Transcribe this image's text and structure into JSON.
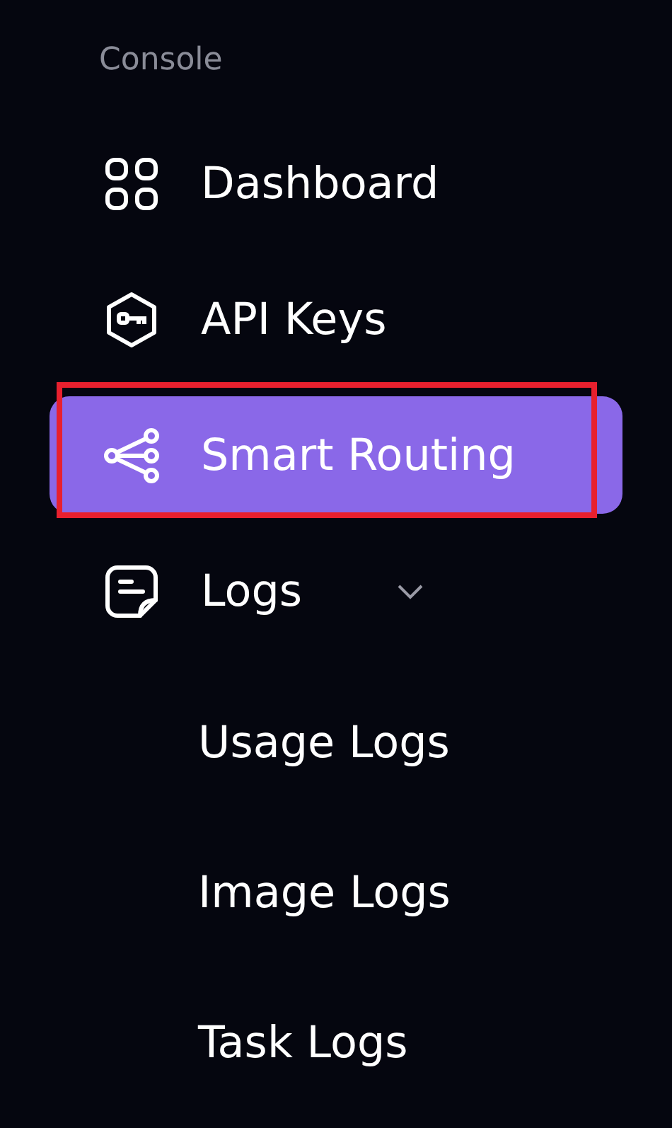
{
  "section_label": "Console",
  "items": [
    {
      "label": "Dashboard",
      "kind": "grid",
      "selected": false,
      "highlighted": false
    },
    {
      "label": "API Keys",
      "kind": "key",
      "selected": false,
      "highlighted": false
    },
    {
      "label": "Smart Routing",
      "kind": "share",
      "selected": true,
      "highlighted": true
    },
    {
      "label": "Logs",
      "kind": "note",
      "selected": false,
      "highlighted": false,
      "expanded": true,
      "children": [
        {
          "label": "Usage Logs",
          "selected": false
        },
        {
          "label": "Image Logs",
          "selected": false
        },
        {
          "label": "Task Logs",
          "selected": false
        }
      ]
    }
  ]
}
